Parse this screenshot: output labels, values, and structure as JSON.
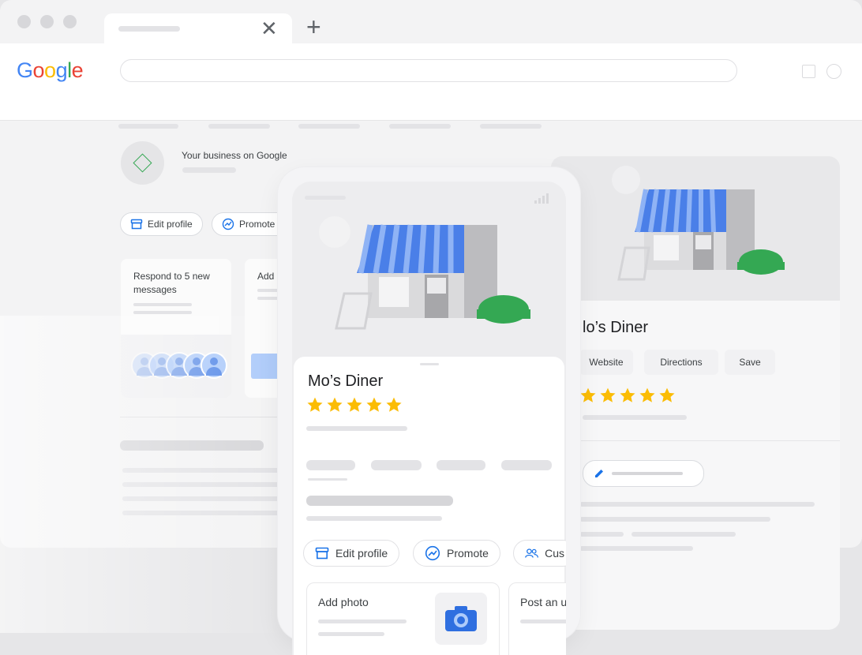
{
  "browser": {
    "new_tab_glyph": "+",
    "close_tab_glyph": "✕",
    "logo": [
      "G",
      "o",
      "o",
      "g",
      "l",
      "e"
    ],
    "logo_colors": [
      "#4285F4",
      "#EA4335",
      "#FBBC05",
      "#4285F4",
      "#34A853",
      "#EA4335"
    ]
  },
  "dashboard": {
    "business_heading": "Your business on Google",
    "chips": [
      {
        "label": "Edit profile",
        "icon": "storefront-icon"
      },
      {
        "label": "Promote",
        "icon": "trending-up-icon"
      }
    ],
    "cards": [
      {
        "text": "Respond to 5 new messages"
      },
      {
        "text": "Add"
      }
    ]
  },
  "listing": {
    "name_partial": "lo’s Diner",
    "buttons": [
      "Website",
      "Directions",
      "Save"
    ],
    "rating": 5,
    "edit_icon": "pencil-icon"
  },
  "phone": {
    "name": "Mo’s Diner",
    "rating": 5,
    "chips": [
      {
        "label": "Edit profile",
        "icon": "storefront-icon"
      },
      {
        "label": "Promote",
        "icon": "trending-up-icon"
      },
      {
        "label": "Cus",
        "icon": "people-icon"
      }
    ],
    "tiles": [
      {
        "label": "Add photo",
        "icon": "camera-icon"
      },
      {
        "label": "Post an u"
      }
    ]
  },
  "colors": {
    "accent_blue": "#4285F4",
    "star_yellow": "#FBBC04",
    "bush_green": "#34A853"
  }
}
